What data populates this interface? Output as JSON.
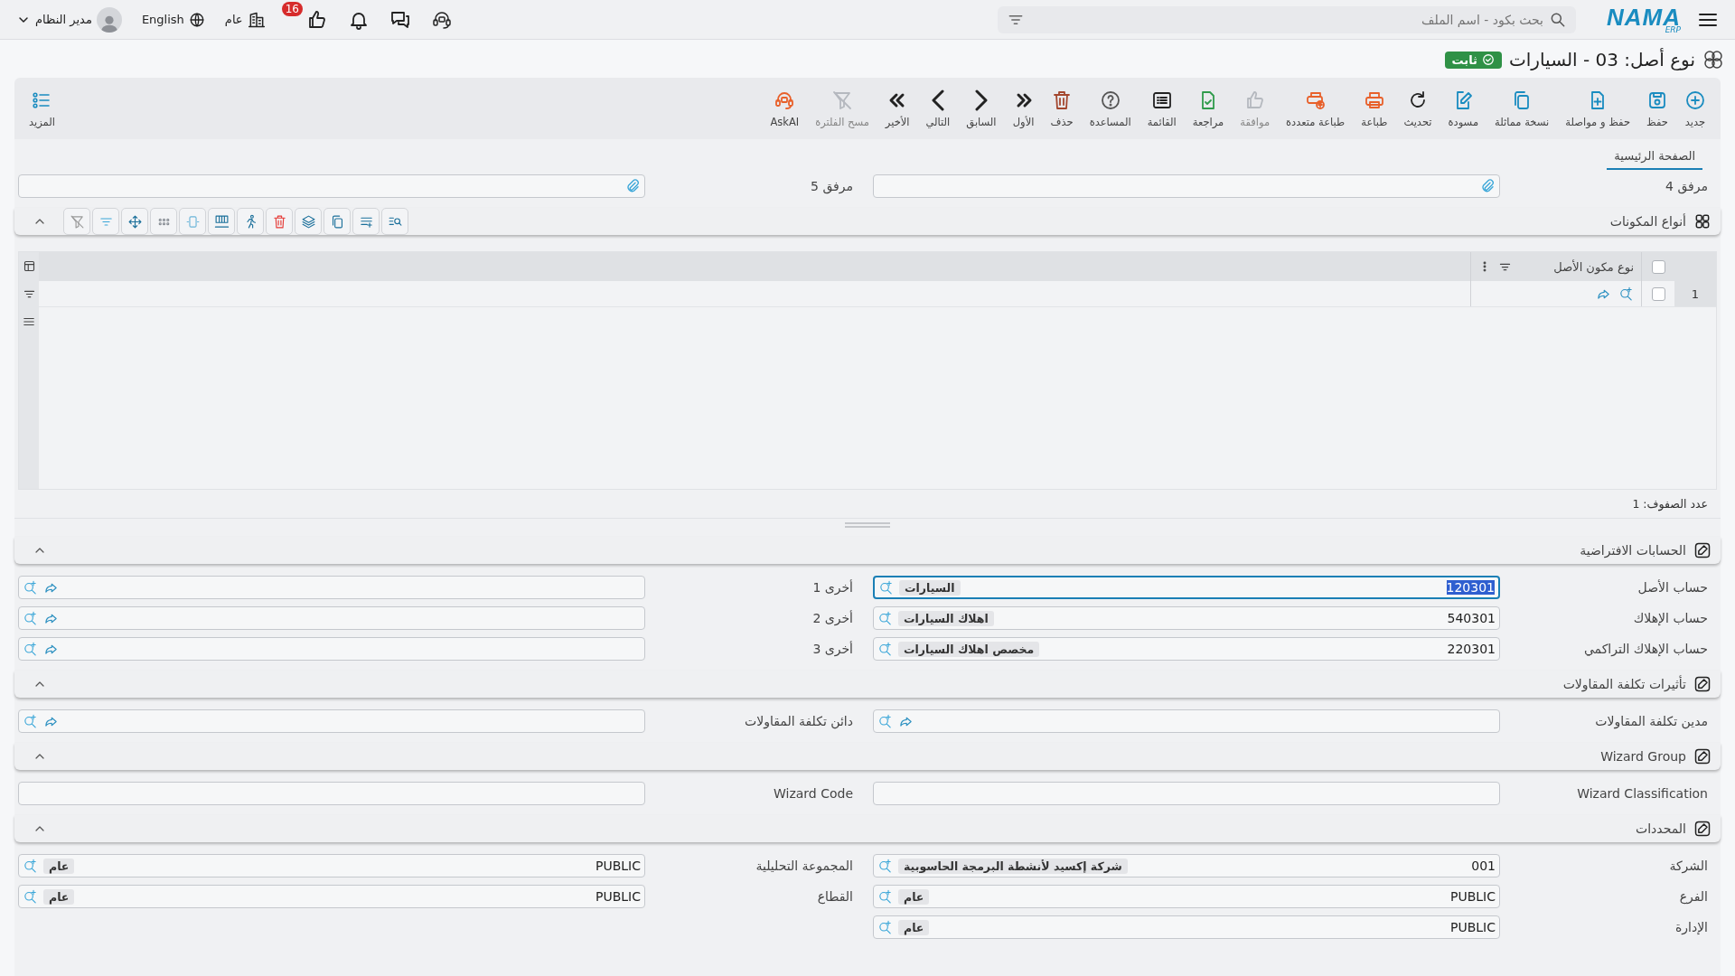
{
  "topbar": {
    "logo": "NAMA",
    "logo_sub": "ERP",
    "search": {
      "placeholder": "بحث بكود - اسم الملف"
    },
    "badge": "16",
    "company": "عام",
    "language": "English",
    "user": "مدير النظام"
  },
  "title": "نوع أصل: 03 - السيارات",
  "status": "ثابت",
  "toolbar": [
    {
      "label": "جديد",
      "kind": "plus",
      "color": "#1a8cc0",
      "disabled": false
    },
    {
      "label": "حفظ",
      "kind": "save",
      "color": "#1a8cc0",
      "disabled": false
    },
    {
      "label": "حفظ و مواصلة",
      "kind": "file-plus",
      "color": "#1a8cc0",
      "disabled": false
    },
    {
      "label": "نسخة مماثلة",
      "kind": "copy",
      "color": "#1a8cc0",
      "disabled": false
    },
    {
      "label": "مسودة",
      "kind": "edit",
      "color": "#1a8cc0",
      "disabled": false
    },
    {
      "label": "تحديث",
      "kind": "refresh",
      "color": "#222222",
      "disabled": false
    },
    {
      "label": "طباعة",
      "kind": "printer",
      "color": "#e8602a",
      "disabled": false
    },
    {
      "label": "طباعة متعددة",
      "kind": "printer-plus",
      "color": "#e8602a",
      "disabled": false
    },
    {
      "label": "موافقة",
      "kind": "thumb",
      "disabled": true
    },
    {
      "label": "مراجعة",
      "kind": "file-check",
      "color": "#2f9b4b",
      "disabled": false
    },
    {
      "label": "القائمة",
      "kind": "list",
      "color": "#222222",
      "disabled": false
    },
    {
      "label": "المساعدة",
      "kind": "help",
      "color": "#555555",
      "disabled": false
    },
    {
      "label": "حذف",
      "kind": "trash",
      "color": "#a3462e",
      "disabled": false
    },
    {
      "label": "الأول",
      "kind": "first",
      "color": "#222222",
      "disabled": false
    },
    {
      "label": "السابق",
      "kind": "prev",
      "color": "#222222",
      "disabled": false
    },
    {
      "label": "التالي",
      "kind": "next",
      "color": "#222222",
      "disabled": false
    },
    {
      "label": "الأخير",
      "kind": "last",
      "color": "#222222",
      "disabled": false
    },
    {
      "label": "مسح الفلترة",
      "kind": "filter-off",
      "disabled": true
    },
    {
      "label": "AskAI",
      "kind": "ai",
      "color": "#e8602a",
      "disabled": false
    }
  ],
  "more": "المزيد",
  "tabs": [
    {
      "label": "الصفحة الرئيسية",
      "selected": true
    }
  ],
  "attachments": [
    {
      "label": "مرفق 4"
    },
    {
      "label": "مرفق 5"
    }
  ],
  "components": {
    "title": "أنواع المكونات",
    "expanded": true,
    "header_checked": false,
    "columns": [
      "نوع مكون الأصل"
    ],
    "rows": [
      {
        "number": "1",
        "checked": false
      }
    ],
    "row_count": "عدد الصفوف: 1"
  },
  "sections": [
    {
      "title": "الحسابات الافتراضية",
      "expanded": true,
      "columns": [
        [
          {
            "label": "حساب الأصل",
            "kind": "lookup",
            "code": "120301",
            "name": "السيارات",
            "focused": true
          },
          {
            "label": "حساب الإهلاك",
            "kind": "lookup",
            "code": "540301",
            "name": "اهلاك السيارات",
            "focused": false
          },
          {
            "label": "حساب الإهلاك التراكمي",
            "kind": "lookup",
            "code": "220301",
            "name": "مخصص اهلاك السيارات",
            "focused": false
          }
        ],
        [
          {
            "label": "أخرى 1",
            "kind": "lookup",
            "focused": false
          },
          {
            "label": "أخرى 2",
            "kind": "lookup",
            "focused": false
          },
          {
            "label": "أخرى 3",
            "kind": "lookup",
            "focused": false
          }
        ]
      ]
    },
    {
      "title": "تأثيرات تكلفة المقاولات",
      "expanded": true,
      "columns": [
        [
          {
            "label": "مدين تكلفة المقاولات",
            "kind": "lookup",
            "focused": false
          }
        ],
        [
          {
            "label": "دائن تكلفة المقاولات",
            "kind": "lookup",
            "focused": false
          }
        ]
      ]
    },
    {
      "title": "Wizard Group",
      "expanded": true,
      "columns": [
        [
          {
            "label": "Wizard Classification",
            "kind": "text",
            "focused": false
          }
        ],
        [
          {
            "label": "Wizard Code",
            "kind": "text",
            "focused": false
          }
        ]
      ]
    },
    {
      "title": "المحددات",
      "expanded": true,
      "columns": [
        [
          {
            "label": "الشركة",
            "kind": "lookup",
            "code": "001",
            "name": "شركة إكسيد لأنشطة البرمجة الحاسوبية",
            "focused": false
          },
          {
            "label": "الفرع",
            "kind": "lookup",
            "code": "PUBLIC",
            "name": "عام",
            "focused": false
          },
          {
            "label": "الإدارة",
            "kind": "lookup",
            "code": "PUBLIC",
            "name": "عام",
            "focused": false
          }
        ],
        [
          {
            "label": "المجموعة التحليلية",
            "kind": "lookup",
            "code": "PUBLIC",
            "name": "عام",
            "focused": false
          },
          {
            "label": "القطاع",
            "kind": "lookup",
            "code": "PUBLIC",
            "name": "عام",
            "focused": false
          }
        ]
      ]
    }
  ]
}
